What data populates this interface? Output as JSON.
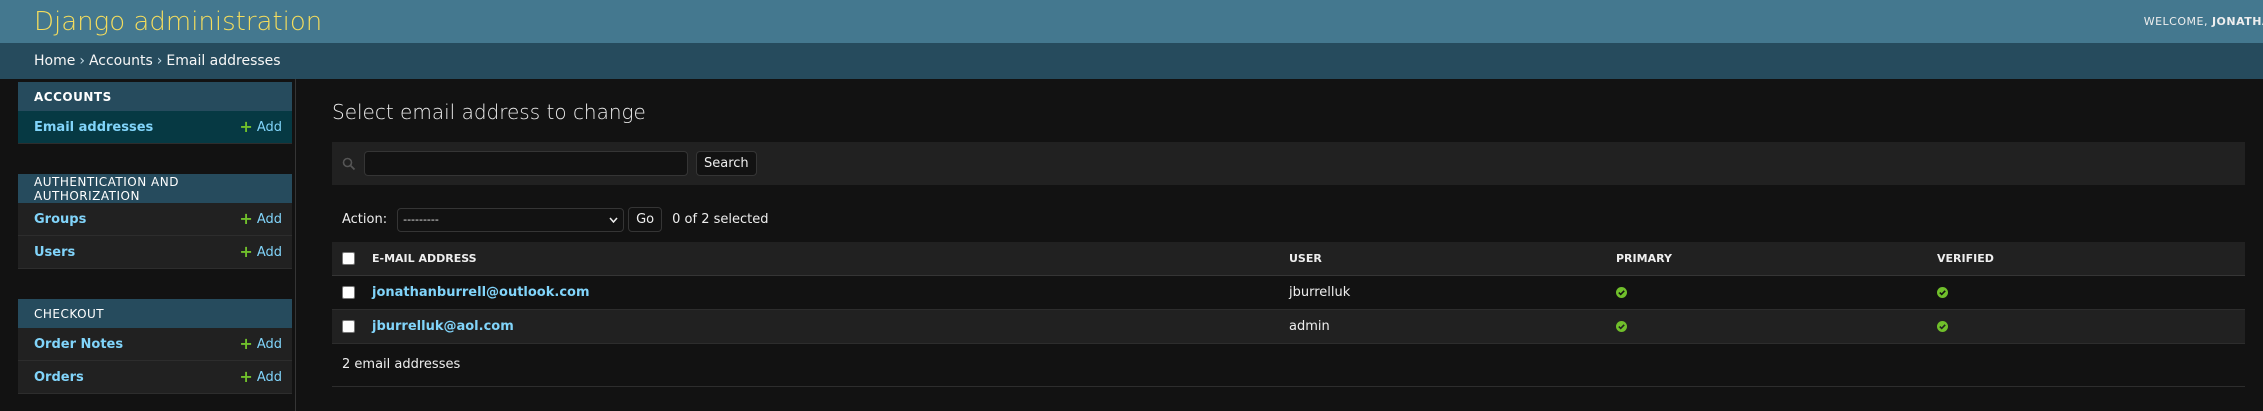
{
  "header": {
    "site_name": "Django administration",
    "welcome_prefix": "WELCOME, ",
    "username": "JONATHA"
  },
  "breadcrumbs": {
    "home": "Home",
    "app": "Accounts",
    "current": "Email addresses",
    "separator": "›"
  },
  "sidebar": {
    "modules": [
      {
        "caption": "Accounts",
        "rows": [
          {
            "label": "Email addresses",
            "add_label": "Add"
          }
        ]
      },
      {
        "caption": "Authentication and Authorization",
        "rows": [
          {
            "label": "Groups",
            "add_label": "Add"
          },
          {
            "label": "Users",
            "add_label": "Add"
          }
        ]
      },
      {
        "caption": "Checkout",
        "rows": [
          {
            "label": "Order Notes",
            "add_label": "Add"
          },
          {
            "label": "Orders",
            "add_label": "Add"
          }
        ]
      }
    ]
  },
  "content": {
    "title": "Select email address to change",
    "search_button": "Search",
    "search_value": "",
    "action_label": "Action:",
    "action_selected": "---------",
    "go_button": "Go",
    "selection_counter": "0 of 2 selected",
    "columns": [
      "E-mail address",
      "User",
      "Primary",
      "Verified"
    ],
    "rows": [
      {
        "email": "jonathanburrell@outlook.com",
        "user": "jburrelluk",
        "primary": true,
        "verified": true
      },
      {
        "email": "jburrelluk@aol.com",
        "user": "admin",
        "primary": true,
        "verified": true
      }
    ],
    "paginator": "2 email addresses"
  },
  "colors": {
    "header_bg": "#44788f",
    "branding": "#f5dd5d",
    "breadcrumb_bg": "#264b5d",
    "link": "#81d4fa",
    "add_icon": "#70bf2b",
    "yes_icon": "#70bf2b"
  },
  "icons": {
    "search": "search-icon",
    "add": "plus-icon",
    "boolean_yes": "check-circle-icon",
    "select_arrow": "chevron-down-icon"
  }
}
